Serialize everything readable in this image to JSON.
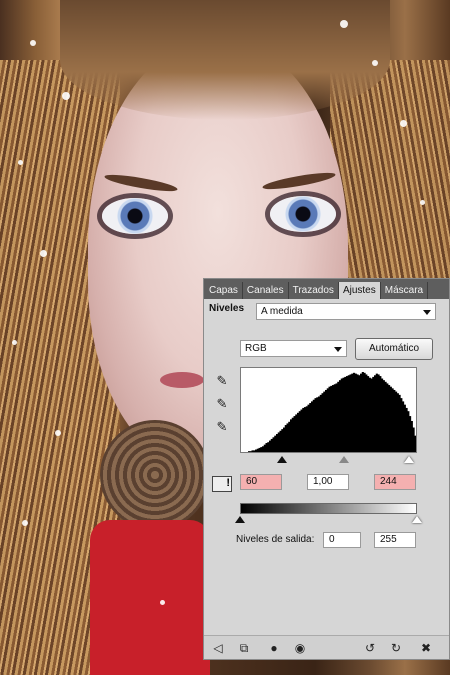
{
  "panel": {
    "tabs": [
      {
        "label": "Capas",
        "active": false
      },
      {
        "label": "Canales",
        "active": false
      },
      {
        "label": "Trazados",
        "active": false
      },
      {
        "label": "Ajustes",
        "active": true
      },
      {
        "label": "Máscara",
        "active": false
      }
    ],
    "adjustment_title": "Niveles",
    "preset_value": "A medida",
    "channel_value": "RGB",
    "auto_button": "Automático",
    "input_levels": {
      "black": "60",
      "gamma": "1,00",
      "white": "244"
    },
    "output_label": "Niveles de salida:",
    "output_levels": {
      "black": "0",
      "white": "255"
    },
    "input_slider_fraction": {
      "black": 0.235,
      "gamma": 0.59,
      "white": 0.957
    },
    "output_slider_fraction": {
      "black": 0.0,
      "white": 1.0
    },
    "warning_color": "#f4b0b0",
    "icons": {
      "dropper_black": "black-eyedropper-icon",
      "dropper_gray": "gray-eyedropper-icon",
      "dropper_white": "white-eyedropper-icon",
      "clip_warning": "clipping-warning-icon",
      "back": "back-arrow-icon",
      "clip_layer": "clip-to-layer-icon",
      "mask": "mask-icon",
      "visibility": "eye-icon",
      "previous_state": "previous-state-icon",
      "reset": "reset-icon",
      "delete": "trash-icon"
    }
  },
  "histogram": {
    "bins": [
      0,
      0,
      0,
      0,
      1,
      1,
      2,
      2,
      3,
      4,
      5,
      6,
      7,
      9,
      11,
      12,
      14,
      16,
      18,
      20,
      22,
      24,
      26,
      28,
      30,
      33,
      35,
      37,
      40,
      42,
      44,
      46,
      48,
      50,
      52,
      54,
      55,
      56,
      58,
      60,
      62,
      64,
      66,
      67,
      68,
      70,
      72,
      74,
      76,
      78,
      80,
      81,
      82,
      83,
      84,
      86,
      88,
      90,
      91,
      92,
      93,
      94,
      95,
      96,
      97,
      96,
      95,
      94,
      96,
      98,
      97,
      95,
      93,
      91,
      90,
      92,
      94,
      96,
      95,
      93,
      90,
      88,
      86,
      84,
      82,
      80,
      78,
      76,
      74,
      72,
      70,
      66,
      62,
      58,
      54,
      50,
      44,
      38,
      30,
      20
    ]
  }
}
